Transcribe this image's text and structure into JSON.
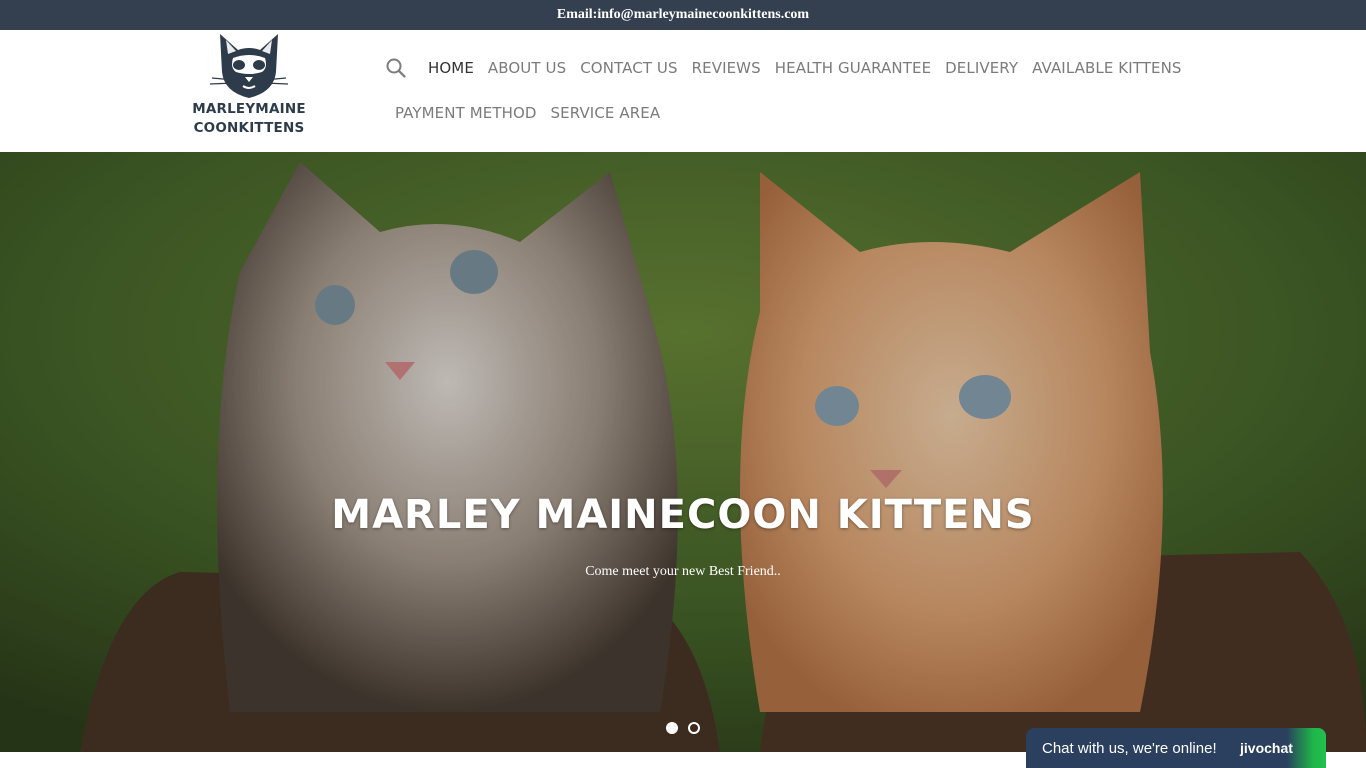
{
  "topbar": {
    "email": "Email:info@marleymainecoonkittens.com"
  },
  "logo": {
    "line1": "MARLEYMAINE",
    "line2": "COONKITTENS",
    "icon": "cat-face-icon"
  },
  "nav": {
    "search_icon": "search-icon",
    "row1": [
      "HOME",
      "ABOUT US",
      "CONTACT US",
      "REVIEWS",
      "HEALTH GUARANTEE",
      "DELIVERY",
      "AVAILABLE KITTENS"
    ],
    "row2": [
      "PAYMENT METHOD",
      "SERVICE AREA"
    ],
    "active": "HOME"
  },
  "hero": {
    "title": "MARLEY MAINECOON KITTENS",
    "subtitle": "Come meet your new Best Friend..",
    "slides": 2,
    "active_slide": 1
  },
  "chat": {
    "text": "Chat with us, we're online!",
    "brand": "jivochat"
  },
  "colors": {
    "topbar": "#34404f",
    "nav_active": "#333333",
    "nav": "#7b7b7b",
    "chat": "#2b3f5e",
    "chat_accent": "#22c14e"
  }
}
